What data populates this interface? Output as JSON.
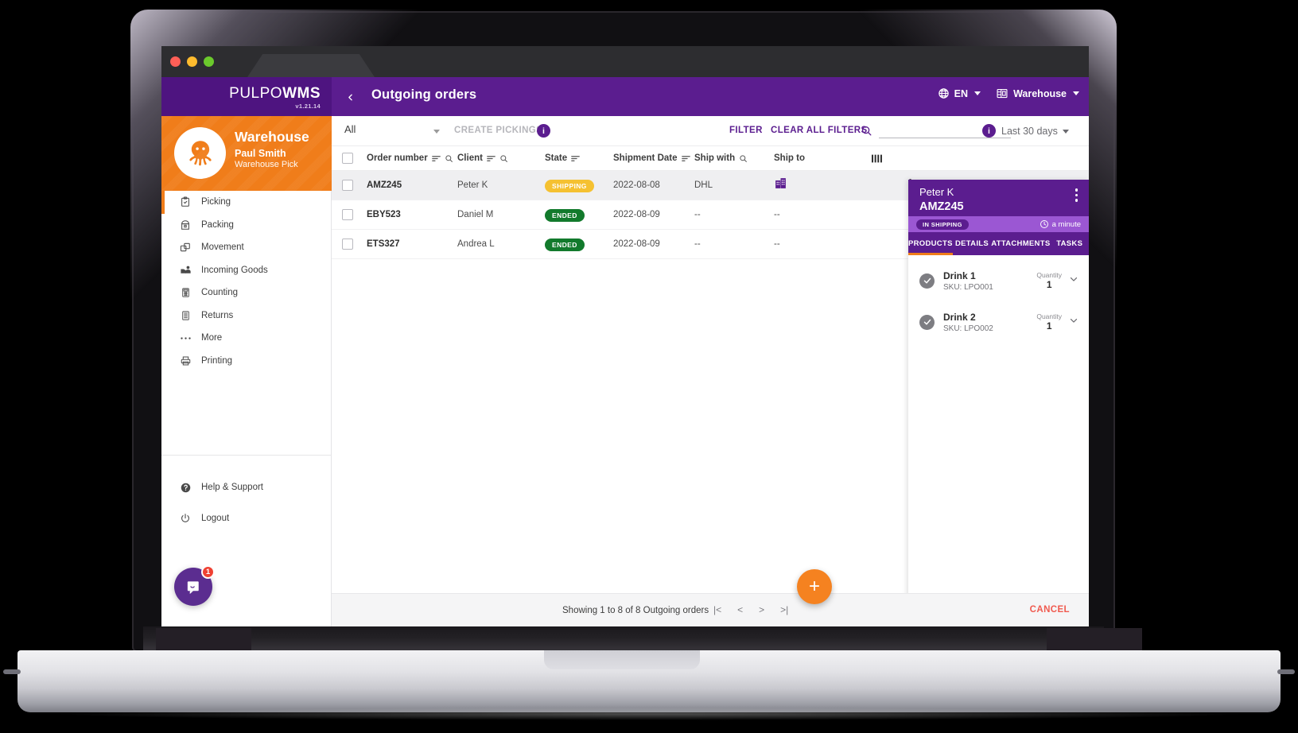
{
  "brand": {
    "name_thin": "PULPO",
    "name_bold": "WMS",
    "version": "v1.21.14"
  },
  "header": {
    "title": "Outgoing orders",
    "back_icon": "chevron-left-icon",
    "language": "EN",
    "warehouse": "Warehouse"
  },
  "user": {
    "title": "Warehouse",
    "name": "Paul Smith",
    "role": "Warehouse Pick"
  },
  "sidebar": {
    "items": [
      {
        "label": "Picking",
        "icon": "clipboard-check-icon",
        "active": true
      },
      {
        "label": "Packing",
        "icon": "package-icon",
        "active": false
      },
      {
        "label": "Movement",
        "icon": "boxes-move-icon",
        "active": false
      },
      {
        "label": "Incoming Goods",
        "icon": "truck-person-icon",
        "active": false
      },
      {
        "label": "Counting",
        "icon": "calculator-icon",
        "active": false
      },
      {
        "label": "Returns",
        "icon": "return-box-icon",
        "active": false
      },
      {
        "label": "More",
        "icon": "ellipsis-icon",
        "active": false
      },
      {
        "label": "Printing",
        "icon": "printer-icon",
        "active": false
      }
    ],
    "footer_items": [
      {
        "label": "Help & Support",
        "icon": "help-circle-icon"
      },
      {
        "label": "Logout",
        "icon": "power-icon"
      }
    ],
    "intercom_badge": "1"
  },
  "toolbar": {
    "status_filter_value": "All",
    "create_pickings_label": "CREATE PICKINGS",
    "create_pickings_info": "i",
    "filter_label": "FILTER",
    "clear_filters_label": "CLEAR ALL FILTERS",
    "search_value": "",
    "search_placeholder": "",
    "date_range_info": "i",
    "date_range_label": "Last 30 days"
  },
  "table": {
    "columns": [
      {
        "label": "Order number",
        "sortable": true,
        "searchable": true
      },
      {
        "label": "Client",
        "sortable": true,
        "searchable": true
      },
      {
        "label": "State",
        "sortable": true,
        "searchable": false
      },
      {
        "label": "Shipment Date",
        "sortable": true,
        "searchable": false
      },
      {
        "label": "Ship with",
        "sortable": false,
        "searchable": true
      },
      {
        "label": "Ship to",
        "sortable": false,
        "searchable": false
      }
    ],
    "rows": [
      {
        "order": "AMZ245",
        "client": "Peter K",
        "state": "SHIPPING",
        "state_type": "shipping",
        "date": "2022-08-08",
        "ship_with": "DHL",
        "ship_to": "building-icon",
        "selected": true
      },
      {
        "order": "EBY523",
        "client": "Daniel M",
        "state": "ENDED",
        "state_type": "ended",
        "date": "2022-08-09",
        "ship_with": "--",
        "ship_to": "--",
        "selected": false
      },
      {
        "order": "ETS327",
        "client": "Andrea L",
        "state": "ENDED",
        "state_type": "ended",
        "date": "2022-08-09",
        "ship_with": "--",
        "ship_to": "--",
        "selected": false
      }
    ]
  },
  "detail_panel": {
    "client": "Peter K",
    "order": "AMZ245",
    "status_badge": "IN SHIPPING",
    "time_ago": "a minute",
    "tabs": [
      {
        "label": "PRODUCTS",
        "active": true
      },
      {
        "label": "DETAILS",
        "active": false
      },
      {
        "label": "ATTACHMENTS",
        "active": false
      },
      {
        "label": "TASKS",
        "active": false
      }
    ],
    "products": [
      {
        "name": "Drink 1",
        "sku": "SKU: LPO001",
        "qty_label": "Quantity",
        "qty": "1"
      },
      {
        "name": "Drink 2",
        "sku": "SKU: LPO002",
        "qty_label": "Quantity",
        "qty": "1"
      }
    ]
  },
  "footer": {
    "showing_text": "Showing 1 to 8 of 8 Outgoing orders",
    "pager": [
      "|<",
      "<",
      ">",
      ">|"
    ],
    "cancel_label": "CANCEL",
    "fab_label": "+"
  },
  "colors": {
    "brand_purple": "#4e1480",
    "header_purple": "#5b1d8f",
    "accent_orange": "#f07d1a",
    "status_shipping": "#f5c131",
    "status_ended": "#127a2c",
    "cancel_red": "#f05a4f",
    "panel_light_purple": "#9b57d3"
  }
}
